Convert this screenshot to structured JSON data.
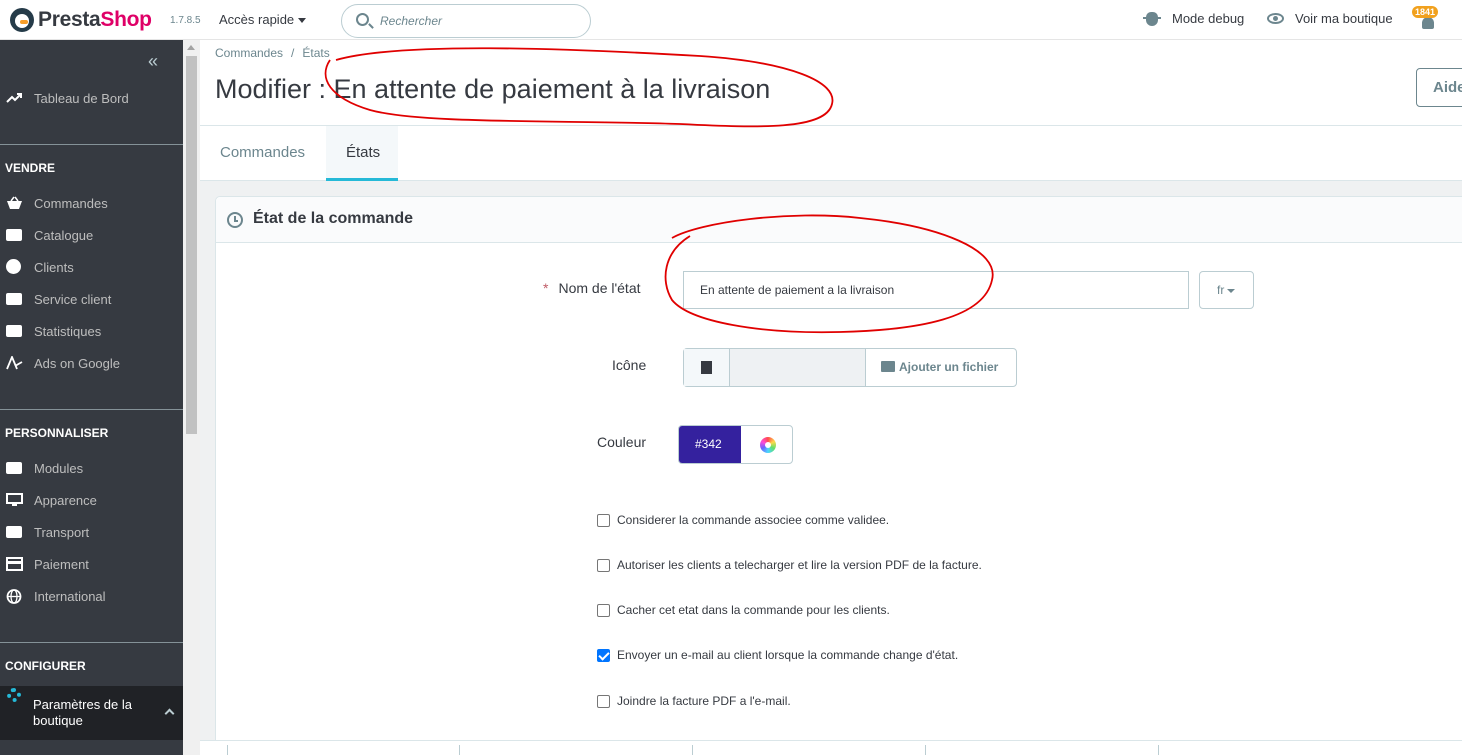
{
  "header": {
    "logo_presta": "Presta",
    "logo_shop": "Shop",
    "version": "1.7.8.5",
    "quick_access": "Accès rapide",
    "search_placeholder": "Rechercher",
    "debug_mode": "Mode debug",
    "view_shop": "Voir ma boutique",
    "notifications_count": "1841"
  },
  "sidebar": {
    "collapse_glyph": "«",
    "dashboard": "Tableau de Bord",
    "sections": [
      {
        "title": "VENDRE",
        "items": [
          "Commandes",
          "Catalogue",
          "Clients",
          "Service client",
          "Statistiques",
          "Ads on Google"
        ]
      },
      {
        "title": "PERSONNALISER",
        "items": [
          "Modules",
          "Apparence",
          "Transport",
          "Paiement",
          "International"
        ]
      },
      {
        "title": "CONFIGURER",
        "items": [
          "Paramètres de la boutique"
        ]
      }
    ]
  },
  "breadcrumb": {
    "parent": "Commandes",
    "separator": "/",
    "current": "États"
  },
  "page_title": "Modifier : En attente de paiement à la livraison",
  "help_label": "Aide",
  "tabs": [
    {
      "label": "Commandes",
      "active": false
    },
    {
      "label": "États",
      "active": true
    }
  ],
  "card": {
    "title": "État de la commande",
    "name_label": "Nom de l'état",
    "name_required_mark": "*",
    "name_value": "En attente de paiement a la livraison",
    "lang": "fr",
    "icon_label": "Icône",
    "add_file": "Ajouter un fichier",
    "color_label": "Couleur",
    "color_value": "#342",
    "color_hex": "#34219e",
    "options": [
      {
        "label": "Considerer la commande associee comme validee.",
        "checked": false
      },
      {
        "label": "Autoriser les clients a telecharger et lire la version PDF de la facture.",
        "checked": false
      },
      {
        "label": "Cacher cet etat dans la commande pour les clients.",
        "checked": false
      },
      {
        "label": "Envoyer un e-mail au client lorsque la commande change d'état.",
        "checked": true
      },
      {
        "label": "Joindre la facture PDF a l'e-mail.",
        "checked": false
      }
    ]
  }
}
